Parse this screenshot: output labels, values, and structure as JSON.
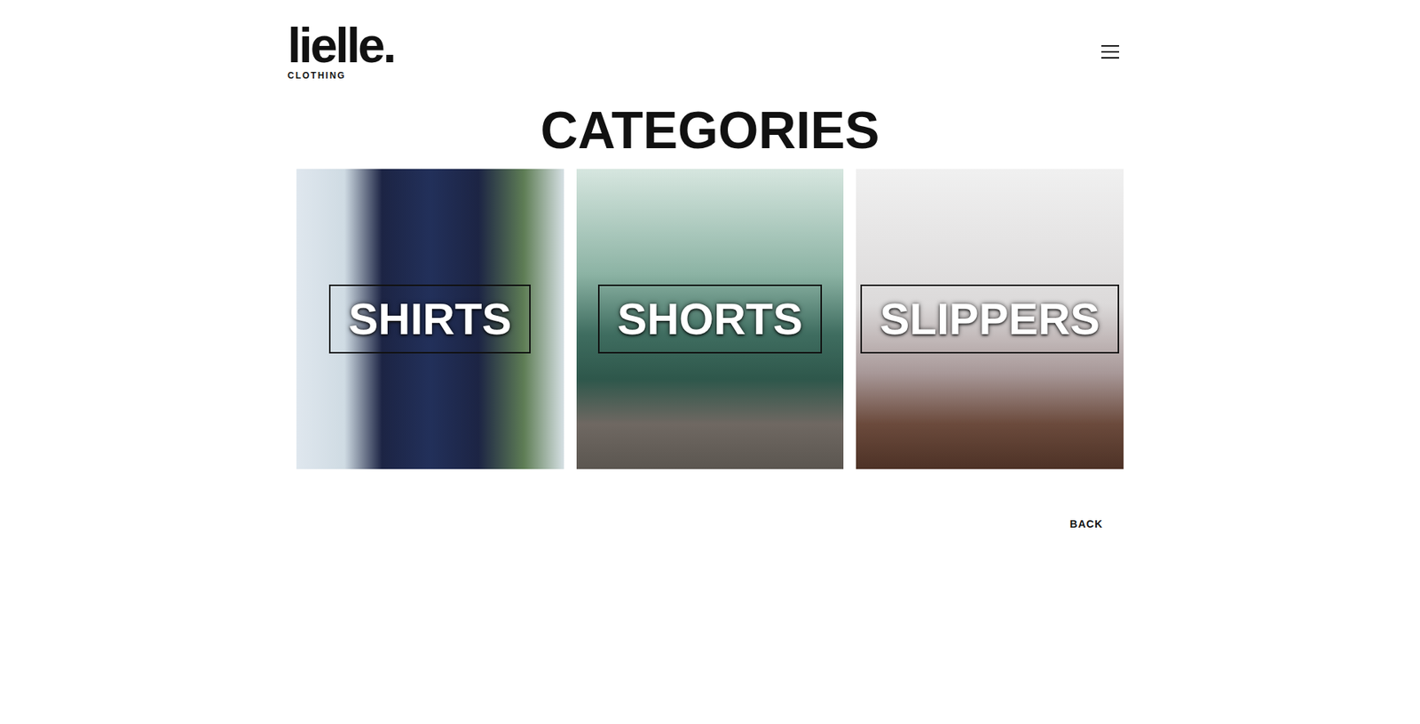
{
  "brand": {
    "logo": "lielle.",
    "tagline": "CLOTHING"
  },
  "page": {
    "title": "CATEGORIES"
  },
  "categories": [
    {
      "label": "SHIRTS"
    },
    {
      "label": "SHORTS"
    },
    {
      "label": "SLIPPERS"
    }
  ],
  "back": "BACK"
}
